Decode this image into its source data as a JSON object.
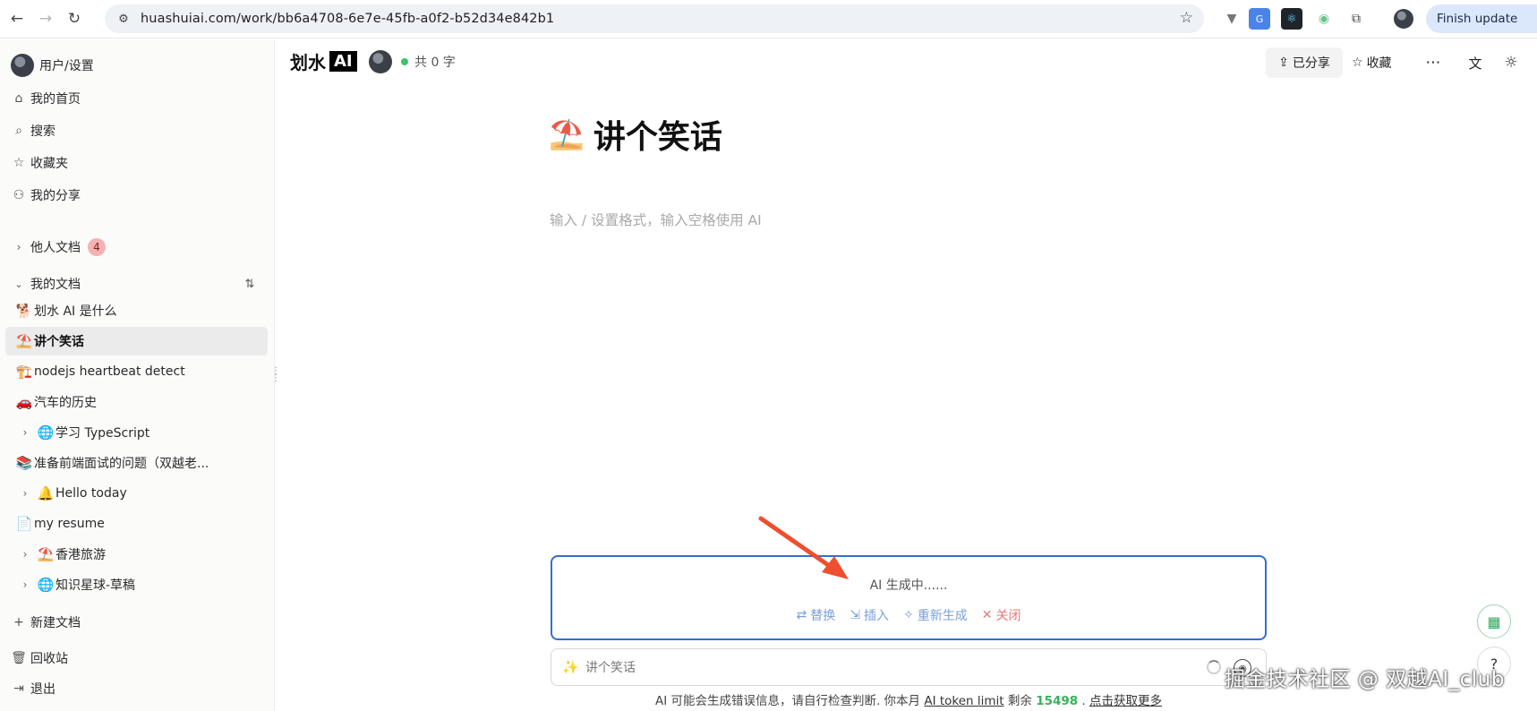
{
  "browser": {
    "url": "huashuiai.com/work/bb6a4708-6e7e-45fb-a0f2-b52d34e842b1",
    "finish_update": "Finish update"
  },
  "sidebar": {
    "user_settings": "用户/设置",
    "nav": [
      {
        "icon": "home-icon",
        "label": "我的首页"
      },
      {
        "icon": "search-icon",
        "label": "搜索"
      },
      {
        "icon": "star-icon",
        "label": "收藏夹"
      },
      {
        "icon": "user-icon",
        "label": "我的分享"
      }
    ],
    "others_docs": {
      "label": "他人文档",
      "count": "4"
    },
    "my_docs": {
      "label": "我的文档"
    },
    "docs": [
      {
        "emoji": "🐕",
        "label": "划水 AI 是什么",
        "expandable": false,
        "active": false
      },
      {
        "emoji": "⛱️",
        "label": "讲个笑话",
        "expandable": false,
        "active": true
      },
      {
        "emoji": "🏗️",
        "label": "nodejs heartbeat detect",
        "expandable": false,
        "active": false
      },
      {
        "emoji": "🚗",
        "label": "汽车的历史",
        "expandable": false,
        "active": false
      },
      {
        "emoji": "🌐",
        "label": "学习 TypeScript",
        "expandable": true,
        "active": false
      },
      {
        "emoji": "📚",
        "label": "准备前端面试的问题（双越老...",
        "expandable": false,
        "active": false
      },
      {
        "emoji": "🔔",
        "label": "Hello today",
        "expandable": true,
        "active": false
      },
      {
        "emoji": "📄",
        "label": "my resume",
        "expandable": false,
        "active": false
      },
      {
        "emoji": "⛱️",
        "label": "香港旅游",
        "expandable": true,
        "active": false
      },
      {
        "emoji": "🌐",
        "label": "知识星球-草稿",
        "expandable": true,
        "active": false
      }
    ],
    "new_doc": "新建文档",
    "trash": "回收站",
    "logout": "退出"
  },
  "header": {
    "brand": "划水",
    "brand_ai": "AI",
    "word_count": "共 0 字",
    "shared": "已分享",
    "favorite": "收藏"
  },
  "document": {
    "emoji": "⛱️",
    "title": "讲个笑话",
    "placeholder": "输入 / 设置格式，输入空格使用 AI"
  },
  "ai_panel": {
    "status": "AI 生成中......",
    "actions": {
      "replace": "替换",
      "insert": "插入",
      "regenerate": "重新生成",
      "close": "关闭"
    },
    "prompt_value": "讲个笑话"
  },
  "disclaimer": {
    "text1": "AI 可能会生成错误信息，请自行检查判断. 你本月",
    "link_limit": "AI token limit",
    "text2": "剩余",
    "remaining": "15498",
    "text3": ".",
    "link_more": "点击获取更多"
  },
  "watermark": "掘金技术社区 @ 双越AI_club",
  "colors": {
    "accent": "#2f6fd1",
    "online": "#3cc36b",
    "remaining": "#36b25a",
    "close": "#e67a7a",
    "annotation_arrow": "#ee4f2e"
  }
}
